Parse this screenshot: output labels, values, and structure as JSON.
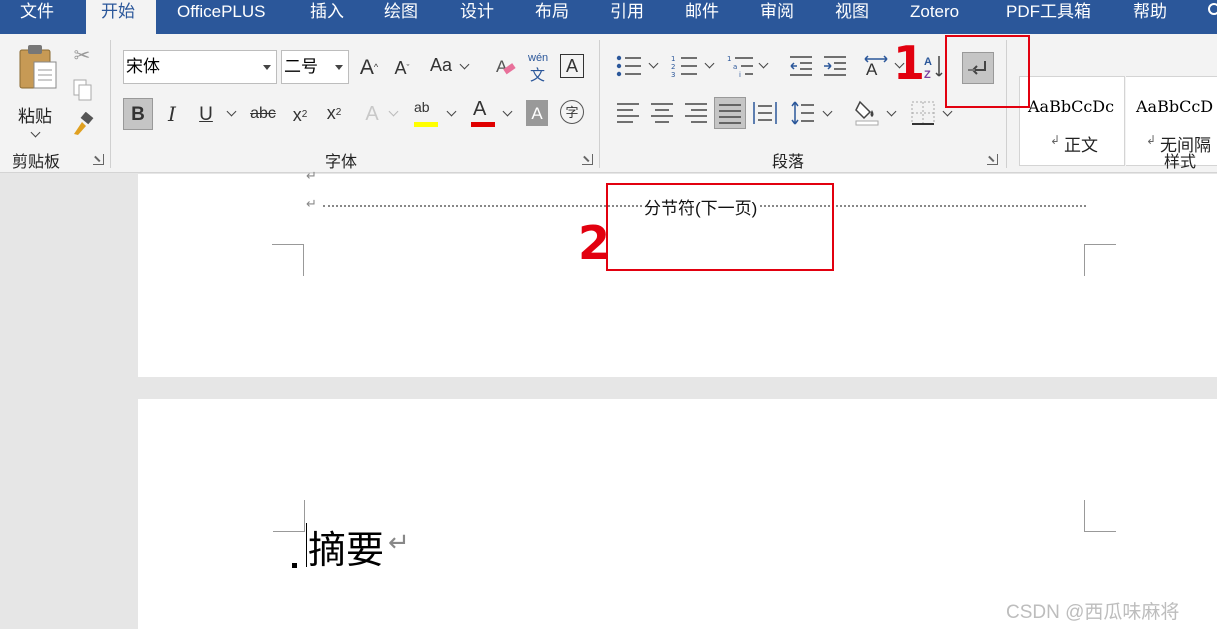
{
  "tabs": [
    "文件",
    "开始",
    "OfficePLUS",
    "插入",
    "绘图",
    "设计",
    "布局",
    "引用",
    "邮件",
    "审阅",
    "视图",
    "Zotero",
    "PDF工具箱",
    "帮助"
  ],
  "clipboard": {
    "paste_label": "粘贴",
    "group_label": "剪贴板"
  },
  "font": {
    "family": "宋体",
    "size": "二号",
    "case_label": "Aa",
    "phonetic_top": "wén",
    "phonetic_bottom": "文",
    "group_label": "字体",
    "colors": {
      "highlight": "#ffff00",
      "font_color": "#e00000"
    }
  },
  "paragraph": {
    "group_label": "段落"
  },
  "styles": {
    "group_label": "样式",
    "items": [
      {
        "preview": "AaBbCcDc",
        "name": "正文"
      },
      {
        "preview": "AaBbCcD",
        "name": "无间隔"
      }
    ]
  },
  "document": {
    "section_break": "分节符(下一页)",
    "heading": "摘要"
  },
  "annotations": {
    "mark1": "1",
    "mark2": "2",
    "color": "#e2000f"
  },
  "watermark": "CSDN @西瓜味麻将",
  "colors": {
    "tab_bar": "#2b579a",
    "ribbon": "#f3f3f3"
  }
}
